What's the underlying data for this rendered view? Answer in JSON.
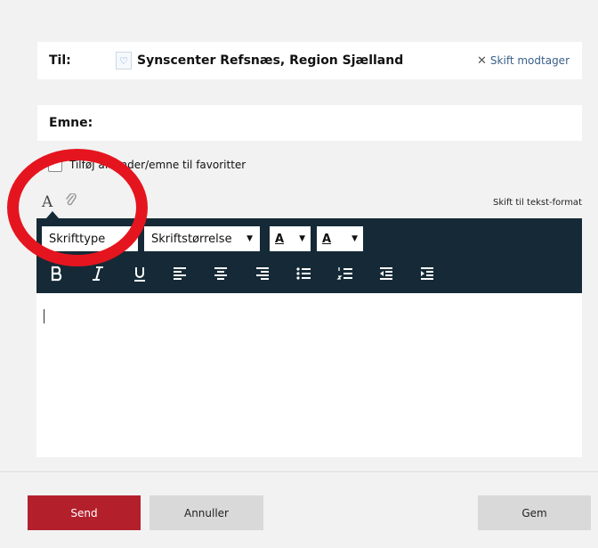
{
  "to": {
    "label": "Til:",
    "recipient": "Synscenter Refsnæs, Region Sjælland",
    "change_label": "Skift modtager"
  },
  "subject": {
    "label": "Emne:",
    "value": ""
  },
  "favorites": {
    "label": "Tilføj afsender/emne til favoritter",
    "checked": false
  },
  "editor": {
    "switch_text_format": "Skift til tekst-format",
    "font_family_label": "Skrifttype",
    "font_size_label": "Skriftstørrelse",
    "text_color_letter": "A",
    "bg_color_letter": "A",
    "toolbar_bg": "#152a36"
  },
  "actions": {
    "send": "Send",
    "cancel": "Annuller",
    "save": "Gem"
  },
  "colors": {
    "send_button": "#b3202b",
    "annotation_circle": "#e5151f"
  },
  "icons": [
    "font-icon",
    "paperclip-icon",
    "bold-icon",
    "italic-icon",
    "underline-icon",
    "align-left-icon",
    "align-center-icon",
    "align-right-icon",
    "bullet-list-icon",
    "numbered-list-icon",
    "outdent-icon",
    "indent-icon",
    "close-icon",
    "recipient-icon"
  ]
}
